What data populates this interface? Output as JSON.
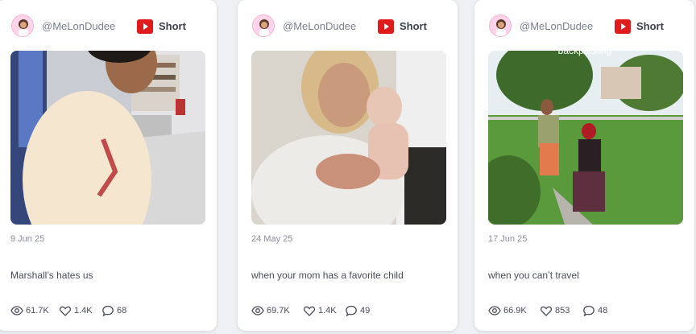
{
  "posts": [
    {
      "author": "@MeLonDudee",
      "platform_icon": "youtube-icon",
      "type_label": "Short",
      "date": "9 Jun 25",
      "caption": "Marshall’s hates us",
      "views": "61.7K",
      "likes": "1.4K",
      "comments": "68",
      "thumbnail_text": ""
    },
    {
      "author": "@MeLonDudee",
      "platform_icon": "youtube-icon",
      "type_label": "Short",
      "date": "24 May 25",
      "caption": "when your mom has a favorite child",
      "views": "69.7K",
      "likes": "1.4K",
      "comments": "49",
      "thumbnail_text": ""
    },
    {
      "author": "@MeLonDudee",
      "platform_icon": "youtube-icon",
      "type_label": "Short",
      "date": "17 Jun 25",
      "caption": "when you can’t travel",
      "views": "66.9K",
      "likes": "853",
      "comments": "48",
      "thumbnail_text": "backpacking"
    }
  ],
  "colors": {
    "youtube_red": "#e01b1b",
    "card_bg": "#ffffff",
    "page_bg": "#eef0f4"
  }
}
